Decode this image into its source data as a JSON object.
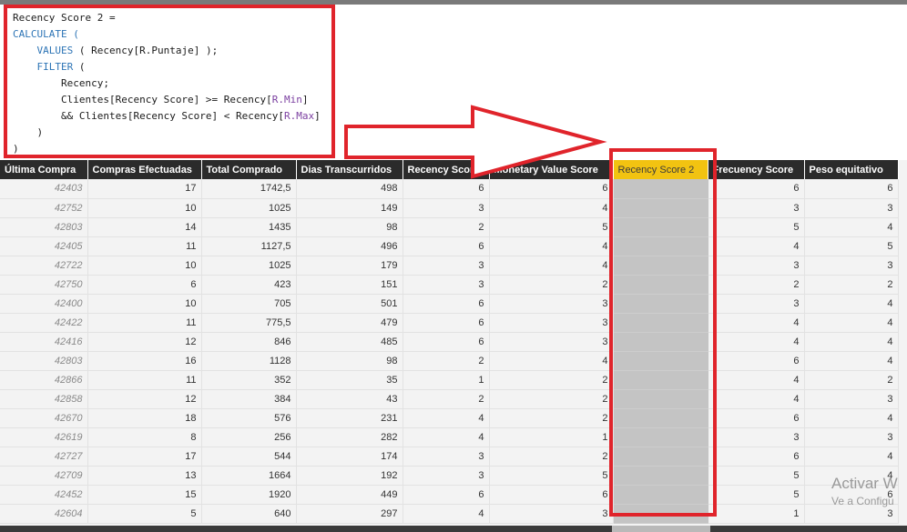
{
  "formula": {
    "line1": "Recency Score 2 =",
    "line2": "CALCULATE (",
    "line3_fn": "VALUES",
    "line3_rest": " ( Recency[R.Puntaje] );",
    "line4_fn": "FILTER",
    "line4_rest": " (",
    "line5": "Recency;",
    "line6_a": "Clientes[Recency Score] >= Recency[",
    "line6_col": "R.Min",
    "line6_b": "]",
    "line7_a": "&& Clientes[Recency Score] < Recency[",
    "line7_col": "R.Max",
    "line7_b": "]",
    "line8": ")",
    "line9": ")"
  },
  "table": {
    "headers": [
      "Última Compra",
      "Compras Efectuadas",
      "Total Comprado",
      "Dias Transcurridos",
      "Recency Score",
      "Monetary Value Score",
      "Recency Score 2",
      "Frecuency Score",
      "Peso equitativo"
    ],
    "rows": [
      [
        "42403",
        "17",
        "1742,5",
        "498",
        "6",
        "6",
        "",
        "6",
        "6"
      ],
      [
        "42752",
        "10",
        "1025",
        "149",
        "3",
        "4",
        "",
        "3",
        "3"
      ],
      [
        "42803",
        "14",
        "1435",
        "98",
        "2",
        "5",
        "",
        "5",
        "4"
      ],
      [
        "42405",
        "11",
        "1127,5",
        "496",
        "6",
        "4",
        "",
        "4",
        "5"
      ],
      [
        "42722",
        "10",
        "1025",
        "179",
        "3",
        "4",
        "",
        "3",
        "3"
      ],
      [
        "42750",
        "6",
        "423",
        "151",
        "3",
        "2",
        "",
        "2",
        "2"
      ],
      [
        "42400",
        "10",
        "705",
        "501",
        "6",
        "3",
        "",
        "3",
        "4"
      ],
      [
        "42422",
        "11",
        "775,5",
        "479",
        "6",
        "3",
        "",
        "4",
        "4"
      ],
      [
        "42416",
        "12",
        "846",
        "485",
        "6",
        "3",
        "",
        "4",
        "4"
      ],
      [
        "42803",
        "16",
        "1128",
        "98",
        "2",
        "4",
        "",
        "6",
        "4"
      ],
      [
        "42866",
        "11",
        "352",
        "35",
        "1",
        "2",
        "",
        "4",
        "2"
      ],
      [
        "42858",
        "12",
        "384",
        "43",
        "2",
        "2",
        "",
        "4",
        "3"
      ],
      [
        "42670",
        "18",
        "576",
        "231",
        "4",
        "2",
        "",
        "6",
        "4"
      ],
      [
        "42619",
        "8",
        "256",
        "282",
        "4",
        "1",
        "",
        "3",
        "3"
      ],
      [
        "42727",
        "17",
        "544",
        "174",
        "3",
        "2",
        "",
        "6",
        "4"
      ],
      [
        "42709",
        "13",
        "1664",
        "192",
        "3",
        "5",
        "",
        "5",
        "4"
      ],
      [
        "42452",
        "15",
        "1920",
        "449",
        "6",
        "6",
        "",
        "5",
        "6"
      ],
      [
        "42604",
        "5",
        "640",
        "297",
        "4",
        "3",
        "",
        "1",
        "3"
      ]
    ]
  },
  "watermark": {
    "line1": "Activar W",
    "line2": "Ve a Configu"
  },
  "colors": {
    "annotation_red": "#e0242b",
    "header_bg": "#2b2b2b",
    "highlight_header": "#f2c311",
    "highlight_column": "#c4c4c4"
  }
}
